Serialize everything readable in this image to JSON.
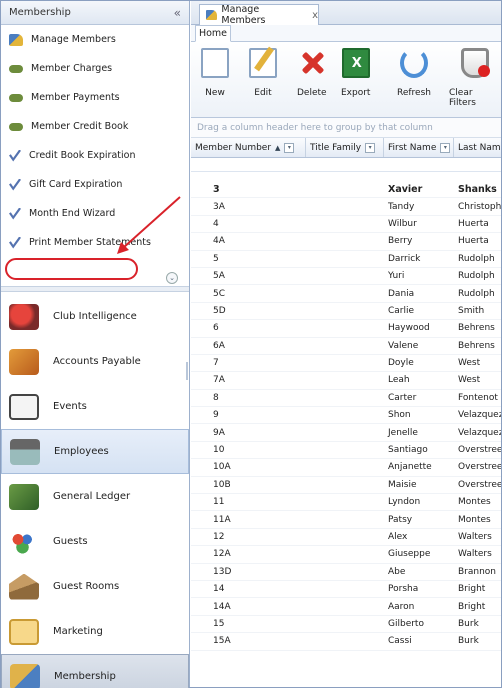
{
  "sidebar": {
    "title": "Membership",
    "collapse_icon": "double-chevron-left-icon",
    "items": [
      {
        "label": "Manage Members",
        "icon": "member-hat-icon"
      },
      {
        "label": "Member Charges",
        "icon": "money-icon"
      },
      {
        "label": "Member Payments",
        "icon": "money-icon"
      },
      {
        "label": "Member Credit Book",
        "icon": "money-icon"
      },
      {
        "label": "Credit Book Expiration",
        "icon": "wizard-icon"
      },
      {
        "label": "Gift Card Expiration",
        "icon": "wizard-icon"
      },
      {
        "label": "Month End Wizard",
        "icon": "wizard-icon"
      },
      {
        "label": "Print Member Statements",
        "icon": "wizard-icon"
      }
    ],
    "modules": [
      {
        "label": "Club Intelligence"
      },
      {
        "label": "Accounts Payable"
      },
      {
        "label": "Events"
      },
      {
        "label": "Employees"
      },
      {
        "label": "General Ledger"
      },
      {
        "label": "Guests"
      },
      {
        "label": "Guest Rooms"
      },
      {
        "label": "Marketing"
      },
      {
        "label": "Membership"
      }
    ]
  },
  "doc_tab": {
    "label": "Manage Members",
    "close": "x"
  },
  "ribbon": {
    "tab": "Home",
    "buttons": [
      "New",
      "Edit",
      "Delete",
      "Export",
      "Refresh",
      "Clear Filters"
    ]
  },
  "grid": {
    "group_hint": "Drag a column header here to group by that column",
    "columns": [
      "Member Number",
      "Title Family",
      "First Name",
      "Last Name"
    ],
    "rows": [
      [
        "3",
        "",
        "Xavier",
        "Shanks"
      ],
      [
        "3A",
        "",
        "Tandy",
        "Christopher"
      ],
      [
        "4",
        "",
        "Wilbur",
        "Huerta"
      ],
      [
        "4A",
        "",
        "Berry",
        "Huerta"
      ],
      [
        "5",
        "",
        "Darrick",
        "Rudolph"
      ],
      [
        "5A",
        "",
        "Yuri",
        "Rudolph"
      ],
      [
        "5C",
        "",
        "Dania",
        "Rudolph"
      ],
      [
        "5D",
        "",
        "Carlie",
        "Smith"
      ],
      [
        "6",
        "",
        "Haywood",
        "Behrens"
      ],
      [
        "6A",
        "",
        "Valene",
        "Behrens"
      ],
      [
        "7",
        "",
        "Doyle",
        "West"
      ],
      [
        "7A",
        "",
        "Leah",
        "West"
      ],
      [
        "8",
        "",
        "Carter",
        "Fontenot"
      ],
      [
        "9",
        "",
        "Shon",
        "Velazquez"
      ],
      [
        "9A",
        "",
        "Jenelle",
        "Velazquez"
      ],
      [
        "10",
        "",
        "Santiago",
        "Overstreet"
      ],
      [
        "10A",
        "",
        "Anjanette",
        "Overstreet"
      ],
      [
        "10B",
        "",
        "Maisie",
        "Overstreet"
      ],
      [
        "11",
        "",
        "Lyndon",
        "Montes"
      ],
      [
        "11A",
        "",
        "Patsy",
        "Montes"
      ],
      [
        "12",
        "",
        "Alex",
        "Walters"
      ],
      [
        "12A",
        "",
        "Giuseppe",
        "Walters"
      ],
      [
        "13D",
        "",
        "Abe",
        "Brannon"
      ],
      [
        "14",
        "",
        "Porsha",
        "Bright"
      ],
      [
        "14A",
        "",
        "Aaron",
        "Bright"
      ],
      [
        "15",
        "",
        "Gilberto",
        "Burk"
      ],
      [
        "15A",
        "",
        "Cassi",
        "Burk"
      ]
    ]
  },
  "colors": {
    "annotation_red": "#d9222a",
    "header_blue": "#dbe4f0"
  }
}
